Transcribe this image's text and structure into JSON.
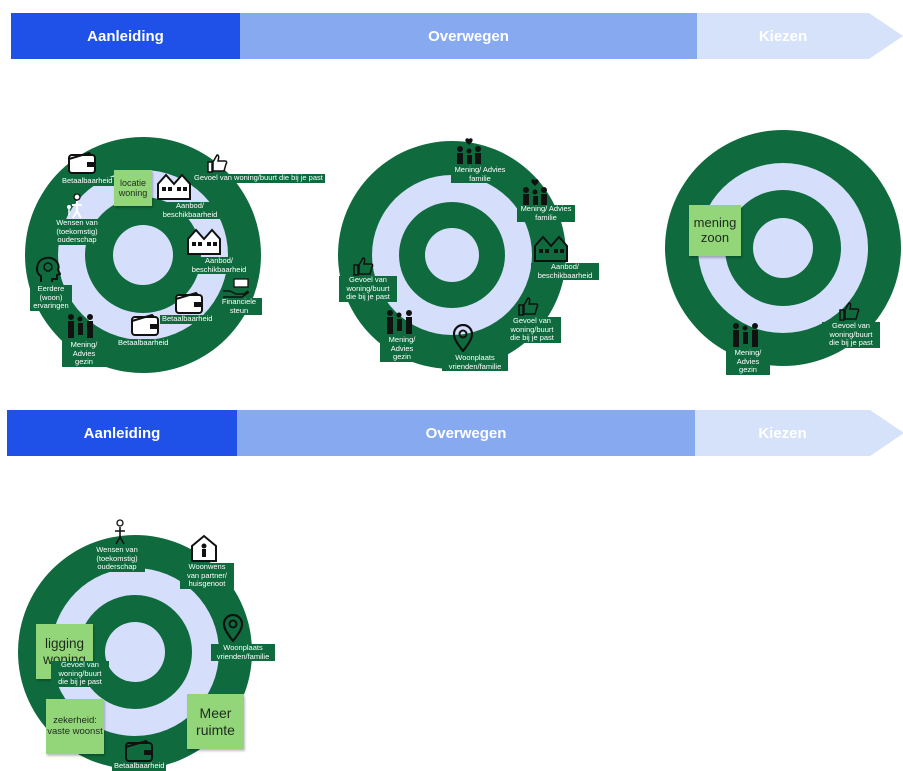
{
  "phases_top": {
    "aanleiding": "Aanleiding",
    "overwegen": "Overwegen",
    "kiezen": "Kiezen"
  },
  "phases_bottom": {
    "aanleiding": "Aanleiding",
    "overwegen": "Overwegen",
    "kiezen": "Kiezen"
  },
  "colors": {
    "aanleiding": "#1f50e8",
    "overwegen": "#87a9ef",
    "kiezen": "#d5e2fa",
    "ring_dark": "#0f6b3e",
    "ring_light": "#d5defa",
    "note": "#93d67a"
  },
  "target1": {
    "betaalbaarheid_top": "Betaalbaarheid",
    "note_locatie": "locatie woning",
    "gevoel": "Gevoel van woning/buurt die bij je past",
    "aanbod_1": "Aanbod/ beschikbaarheid",
    "wensen": "Wensen van (toekomstig) ouderschap",
    "aanbod_2": "Aanbod/ beschikbaarheid",
    "eerdere": "Eerdere (woon) ervaringen",
    "financiele": "Financiele steun",
    "betaalbaarheid_mid": "Betaalbaarheid",
    "mening_gezin": "Mening/ Advies gezin",
    "betaalbaarheid_bottom": "Betaalbaarheid"
  },
  "target2": {
    "mening_familie_1": "Mening/ Advies familie",
    "mening_familie_2": "Mening/ Advies familie",
    "aanbod": "Aanbod/ beschikbaarheid",
    "gevoel_left": "Gevoel van woning/buurt die bij je past",
    "gevoel_right": "Gevoel van woning/buurt die bij je past",
    "mening_gezin": "Mening/ Advies gezin",
    "woonplaats": "Woonplaats vrienden/familie"
  },
  "target3": {
    "note_mening": "mening zoon",
    "gevoel": "Gevoel van woning/buurt die bij je past",
    "mening_gezin": "Mening/ Advies gezin"
  },
  "target4": {
    "wensen": "Wensen van (toekomstig) ouderschap",
    "woonwens": "Woonwens van partner/ huisgenoot",
    "woonplaats": "Woonplaats vrienden/familie",
    "note_ligging": "ligging woning",
    "gevoel": "Gevoel van woning/buurt die bij je past",
    "note_zekerheid": "zekerheid: vaste woonst",
    "note_meer": "Meer ruimte",
    "betaalbaarheid": "Betaalbaarheid"
  },
  "icons": [
    "wallet-icon",
    "thumbs-up-icon",
    "houses-icon",
    "person-child-icon",
    "head-idea-icon",
    "hand-money-icon",
    "family-icon",
    "family-heart-icon",
    "location-pin-icon",
    "house-person-icon"
  ]
}
